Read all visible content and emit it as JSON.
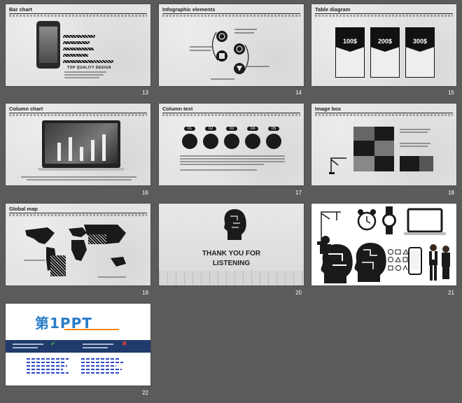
{
  "slides": [
    {
      "title": "Bar chart",
      "number": "13",
      "caption": "TOP QUALITY DESIGN"
    },
    {
      "title": "Infographic elements",
      "number": "14"
    },
    {
      "title": "Table diagram",
      "number": "15",
      "prices": [
        "100$",
        "200$",
        "300$"
      ]
    },
    {
      "title": "Column chart",
      "number": "16"
    },
    {
      "title": "Column text",
      "number": "17",
      "steps": [
        "01",
        "02",
        "03",
        "04",
        "05"
      ]
    },
    {
      "title": "Image box",
      "number": "18"
    },
    {
      "title": "Global map",
      "number": "19"
    },
    {
      "title": "",
      "number": "20",
      "thanks_line1": "THANK YOU FOR",
      "thanks_line2": "LISTENING"
    },
    {
      "title": "",
      "number": "21"
    },
    {
      "title": "",
      "number": "22",
      "logo_text": "第1PPT"
    }
  ],
  "colors": {
    "background": "#5b5b5b",
    "slide": "#e3e3e3",
    "ink": "#1a1a1a",
    "logo_blue": "#2a7cc7",
    "logo_orange": "#f08a1c",
    "banner": "#1f3a6b"
  }
}
